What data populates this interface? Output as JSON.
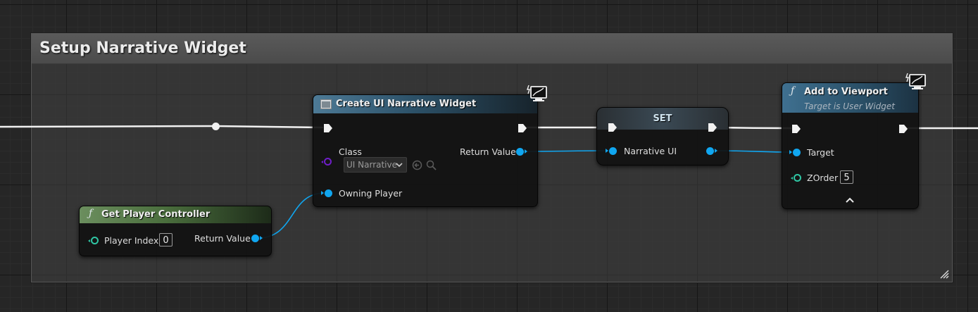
{
  "comment": {
    "title": "Setup Narrative Widget"
  },
  "nodes": {
    "create_widget": {
      "title": "Create UI Narrative Widget",
      "class_label": "Class",
      "class_value": "UI Narrative",
      "return_label": "Return Value",
      "owning_player_label": "Owning Player"
    },
    "set": {
      "title": "SET",
      "var_label": "Narrative UI"
    },
    "add_viewport": {
      "title": "Add to Viewport",
      "subtitle": "Target is User Widget",
      "target_label": "Target",
      "zorder_label": "ZOrder",
      "zorder_value": "5"
    },
    "get_player_controller": {
      "title": "Get Player Controller",
      "player_index_label": "Player Index",
      "player_index_value": "0",
      "return_label": "Return Value"
    }
  },
  "colors": {
    "exec_pin": "#f2f2f2",
    "object_pin": "#10a6f0",
    "integer_pin": "#2fc6a4",
    "class_pin": "#6f1ec9",
    "function_header": "#3d6a86",
    "pure_function_header": "#4a6e3d",
    "set_header": "#323d46"
  },
  "icons": [
    "function-icon",
    "widget-node-icon",
    "client-only-monitor-icon",
    "dropdown-chevron-icon",
    "use-selected-icon",
    "browse-icon",
    "advanced-expand-icon",
    "resize-icon"
  ]
}
